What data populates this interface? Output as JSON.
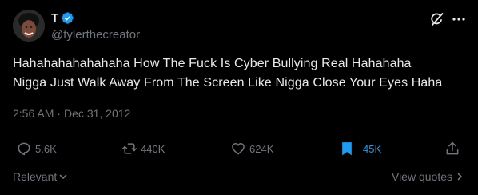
{
  "author": {
    "display_name": "T",
    "handle": "@tylerthecreator",
    "verified": true
  },
  "tweet": {
    "text_line1": "Hahahahahahahaha How The Fuck Is Cyber Bullying Real Hahahaha",
    "text_line2": "Nigga Just Walk Away From The Screen Like Nigga Close Your Eyes Haha",
    "time": "2:56 AM",
    "separator": "·",
    "date": "Dec 31, 2012"
  },
  "actions": {
    "replies": "5.6K",
    "reposts": "440K",
    "likes": "624K",
    "bookmarks": "45K"
  },
  "footer": {
    "sort_label": "Relevant",
    "view_quotes_label": "View quotes"
  },
  "icons": [
    "grok-icon",
    "more-icon",
    "reply-icon",
    "repost-icon",
    "like-icon",
    "bookmark-icon",
    "share-icon",
    "chevron-down-icon",
    "chevron-right-icon"
  ],
  "colors": {
    "background": "#000000",
    "text": "#e7e9ea",
    "muted": "#71767b",
    "accent": "#1d9bf0"
  }
}
